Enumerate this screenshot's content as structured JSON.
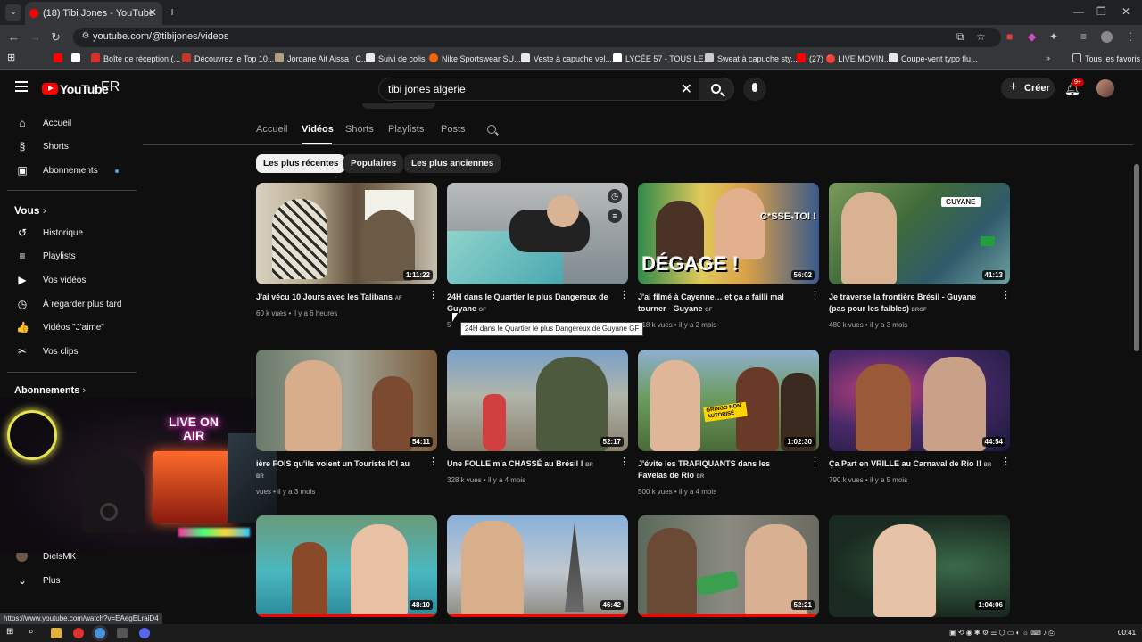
{
  "browser": {
    "tab_title": "(18) Tibi Jones - YouTube",
    "url": "youtube.com/@tibijones/videos",
    "status_url": "https://www.youtube.com/watch?v=EAegELraiD4",
    "bookmarks": [
      "Boîte de réception (...",
      "Découvrez le Top 10...",
      "Jordane Ait Aissa | C...",
      "Suivi de colis",
      "Nike Sportswear SU...",
      "Veste à capuche vel...",
      "LYCÉE 57 - TOUS LE...",
      "Sweat à capuche sty...",
      "(27) 🔴 LIVE MOVIN...",
      "Coupe-vent typo flu..."
    ],
    "all_favorites": "Tous les favoris",
    "bookmark_icons": [
      "#ff4b3a",
      "#ff0000",
      "#d93025",
      "#e8e8e8",
      "#c0392b",
      "#fa6400",
      "#e8e8e8",
      "#ffffff",
      "#cccccc",
      "#ff0000",
      "#e8e8e8"
    ]
  },
  "masthead": {
    "logo_text": "YouTube",
    "country": "FR",
    "search_query": "tibi jones algerie",
    "create_label": "Créer",
    "notif_count": "9+"
  },
  "sidebar": {
    "main": [
      {
        "label": "Accueil",
        "icon": "⌂"
      },
      {
        "label": "Shorts",
        "icon": "§"
      },
      {
        "label": "Abonnements",
        "icon": "▣"
      }
    ],
    "you_header": "Vous",
    "you": [
      {
        "label": "Historique",
        "icon": "↺"
      },
      {
        "label": "Playlists",
        "icon": "≡"
      },
      {
        "label": "Vos vidéos",
        "icon": "▶"
      },
      {
        "label": "À regarder plus tard",
        "icon": "◷"
      },
      {
        "label": "Vidéos \"J'aime\"",
        "icon": "👍"
      },
      {
        "label": "Vos clips",
        "icon": "✂"
      }
    ],
    "subs_header": "Abonnements",
    "subs_item": "DielsMK",
    "more_label": "Plus"
  },
  "channel_tabs": [
    "Accueil",
    "Vidéos",
    "Shorts",
    "Playlists",
    "Posts"
  ],
  "chips": [
    "Les plus récentes",
    "Populaires",
    "Les plus anciennes"
  ],
  "videos": [
    {
      "title": "J'ai vécu 10 Jours avec les Talibans",
      "flag": "AF",
      "views": "60 k vues",
      "age": "il y a 6 heures",
      "duration": "1:11:22",
      "progress": 0
    },
    {
      "title": "24H dans le Quartier le plus Dangereux de Guyane",
      "flag": "GF",
      "views": "5",
      "age": "",
      "duration": "",
      "progress": 0
    },
    {
      "title": "J'ai filmé à Cayenne… et ça a failli mal tourner - Guyane",
      "flag": "GF",
      "views": "418 k vues",
      "age": "il y a 2 mois",
      "duration": "56:02",
      "progress": 0
    },
    {
      "title": "Je traverse la frontière Brésil - Guyane (pas pour les faibles)",
      "flag": "BRGF",
      "views": "480 k vues",
      "age": "il y a 3 mois",
      "duration": "41:13",
      "progress": 0
    },
    {
      "title": "ière FOIS qu'ils voient un Touriste ICI au",
      "flag": "BR",
      "views": "vues",
      "age": "il y a 3 mois",
      "duration": "54:11",
      "progress": 0
    },
    {
      "title": "Une FOLLE m'a CHASSÉ au Brésil !",
      "flag": "BR",
      "views": "328 k vues",
      "age": "il y a 4 mois",
      "duration": "52:17",
      "progress": 0
    },
    {
      "title": "J'évite les TRAFIQUANTS dans les Favelas de Rio",
      "flag": "BR",
      "views": "500 k vues",
      "age": "il y a 4 mois",
      "duration": "1:02:30",
      "progress": 0
    },
    {
      "title": "Ça Part en VRILLE au Carnaval de Rio !!",
      "flag": "BR",
      "views": "790 k vues",
      "age": "il y a 5 mois",
      "duration": "44:54",
      "progress": 0
    },
    {
      "title": "",
      "flag": "",
      "views": "",
      "age": "",
      "duration": "48:10",
      "progress": 1.0
    },
    {
      "title": "",
      "flag": "",
      "views": "",
      "age": "",
      "duration": "46:42",
      "progress": 1.0
    },
    {
      "title": "",
      "flag": "",
      "views": "",
      "age": "",
      "duration": "52:21",
      "progress": 1.0
    },
    {
      "title": "",
      "flag": "",
      "views": "",
      "age": "",
      "duration": "1:04:06",
      "progress": 0
    }
  ],
  "thumb_text": {
    "v3_main": "DÉGAGE !",
    "v3_sub": "C*SSE-TOI !",
    "v4_sign": "GUYANE",
    "v7_sign": "GRINGO NON AUTORISÉ"
  },
  "tooltip": "24H dans le Quartier le plus Dangereux de Guyane GF",
  "webcam": {
    "sign": "LIVE ON AIR"
  },
  "taskbar": {
    "time": "00:41"
  }
}
